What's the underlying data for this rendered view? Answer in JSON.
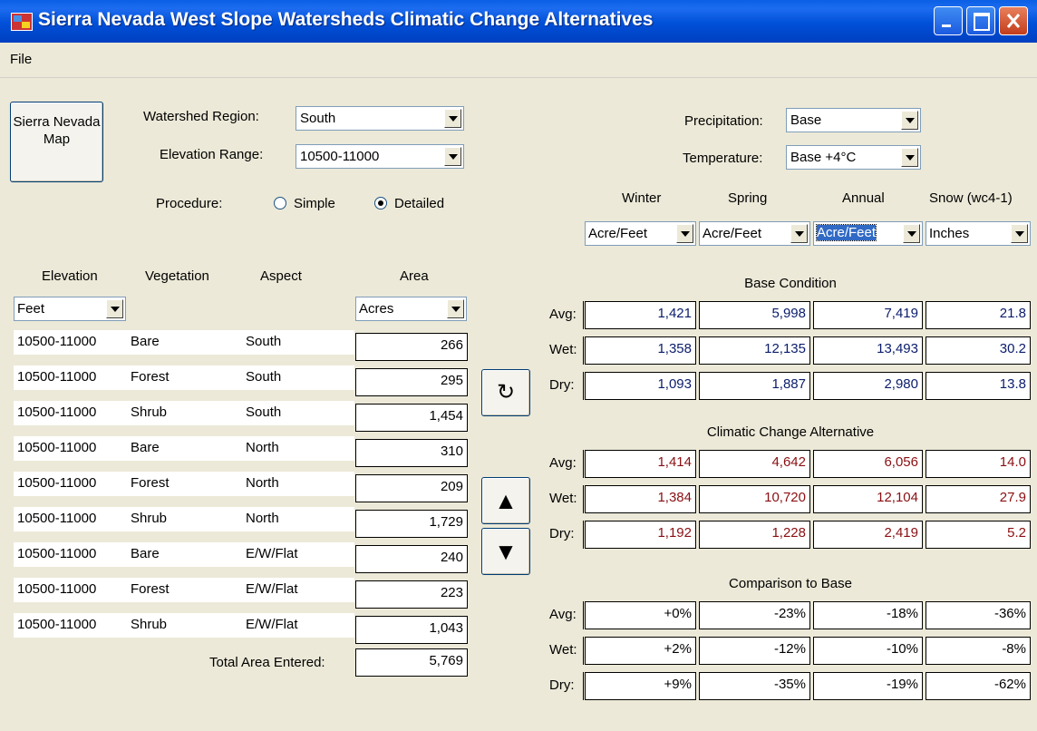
{
  "window": {
    "title": "Sierra Nevada West Slope Watersheds Climatic Change Alternatives"
  },
  "menu": {
    "file": "File"
  },
  "map_button": "Sierra Nevada Map",
  "watershed": {
    "label": "Watershed Region:",
    "value": "South"
  },
  "elevation_range": {
    "label": "Elevation Range:",
    "value": "10500-11000"
  },
  "procedure": {
    "label": "Procedure:",
    "simple": "Simple",
    "detailed": "Detailed",
    "selected": "Detailed"
  },
  "precipitation": {
    "label": "Precipitation:",
    "value": "Base"
  },
  "temperature": {
    "label": "Temperature:",
    "value": "Base +4°C"
  },
  "season_headers": [
    "Winter",
    "Spring",
    "Annual",
    "Snow (wc4-1)"
  ],
  "unit_combos": [
    "Acre/Feet",
    "Acre/Feet",
    "Acre/Feet",
    "Inches"
  ],
  "table": {
    "headers": {
      "elevation": "Elevation",
      "vegetation": "Vegetation",
      "aspect": "Aspect",
      "area": "Area"
    },
    "elevation_unit": "Feet",
    "area_unit": "Acres",
    "rows": [
      {
        "elevation": "10500-11000",
        "vegetation": "Bare",
        "aspect": "South",
        "area": "266"
      },
      {
        "elevation": "10500-11000",
        "vegetation": "Forest",
        "aspect": "South",
        "area": "295"
      },
      {
        "elevation": "10500-11000",
        "vegetation": "Shrub",
        "aspect": "South",
        "area": "1,454"
      },
      {
        "elevation": "10500-11000",
        "vegetation": "Bare",
        "aspect": "North",
        "area": "310"
      },
      {
        "elevation": "10500-11000",
        "vegetation": "Forest",
        "aspect": "North",
        "area": "209"
      },
      {
        "elevation": "10500-11000",
        "vegetation": "Shrub",
        "aspect": "North",
        "area": "1,729"
      },
      {
        "elevation": "10500-11000",
        "vegetation": "Bare",
        "aspect": "E/W/Flat",
        "area": "240"
      },
      {
        "elevation": "10500-11000",
        "vegetation": "Forest",
        "aspect": "E/W/Flat",
        "area": "223"
      },
      {
        "elevation": "10500-11000",
        "vegetation": "Shrub",
        "aspect": "E/W/Flat",
        "area": "1,043"
      }
    ],
    "total_label": "Total Area Entered:",
    "total_value": "5,769"
  },
  "icons": {
    "refresh": "↻",
    "up": "▲",
    "down": "▼"
  },
  "results": {
    "row_labels": [
      "Avg:",
      "Wet:",
      "Dry:"
    ],
    "base": {
      "title": "Base Condition",
      "color": "#0a1c6c",
      "rows": [
        [
          "1,421",
          "5,998",
          "7,419",
          "21.8"
        ],
        [
          "1,358",
          "12,135",
          "13,493",
          "30.2"
        ],
        [
          "1,093",
          "1,887",
          "2,980",
          "13.8"
        ]
      ]
    },
    "alternative": {
      "title": "Climatic Change Alternative",
      "color": "#8a0f12",
      "rows": [
        [
          "1,414",
          "4,642",
          "6,056",
          "14.0"
        ],
        [
          "1,384",
          "10,720",
          "12,104",
          "27.9"
        ],
        [
          "1,192",
          "1,228",
          "2,419",
          "5.2"
        ]
      ]
    },
    "comparison": {
      "title": "Comparison to Base",
      "color": "#000000",
      "rows": [
        [
          "+0%",
          "-23%",
          "-18%",
          "-36%"
        ],
        [
          "+2%",
          "-12%",
          "-10%",
          "-8%"
        ],
        [
          "+9%",
          "-35%",
          "-19%",
          "-62%"
        ]
      ]
    }
  }
}
